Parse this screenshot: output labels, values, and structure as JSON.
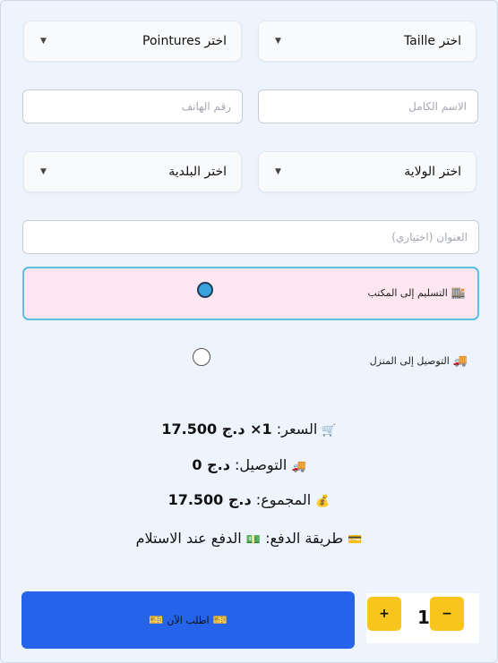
{
  "form": {
    "size_select": "اختر Taille",
    "shoe_size_select": "اختر Pointures",
    "full_name_placeholder": "الاسم الكامل",
    "phone_placeholder": "رقم الهاتف",
    "wilaya_select": "اختر الولاية",
    "commune_select": "اختر البلدية",
    "address_placeholder": "العنوان (اختياري)"
  },
  "delivery": {
    "office_label": "التسليم إلى المكتب",
    "home_label": "التوصيل إلى المنزل",
    "selected": "office",
    "office_icon": "🏬",
    "home_icon": "🚚"
  },
  "summary": {
    "price_label": "السعر:",
    "price_value": "1× د.ج 17.500",
    "price_icon": "🛒",
    "delivery_label": "التوصيل:",
    "delivery_value": "د.ج 0",
    "delivery_icon": "🚚",
    "total_label": "المجموع:",
    "total_value": "د.ج 17.500",
    "total_icon": "💰",
    "payment_label": "طريقة الدفع:",
    "payment_value": "الدفع عند الاستلام",
    "payment_icon": "💳",
    "payment_value_icon": "💵"
  },
  "actions": {
    "order_label": "اطلب الآن",
    "order_icon": "🎫",
    "plus_label": "+",
    "minus_label": "−",
    "quantity": "1"
  },
  "colors": {
    "accent": "#2563eb",
    "qty_button": "#f7c51e",
    "selected_option_bg": "#fce6ef",
    "selected_option_border": "#5bbfe0"
  }
}
